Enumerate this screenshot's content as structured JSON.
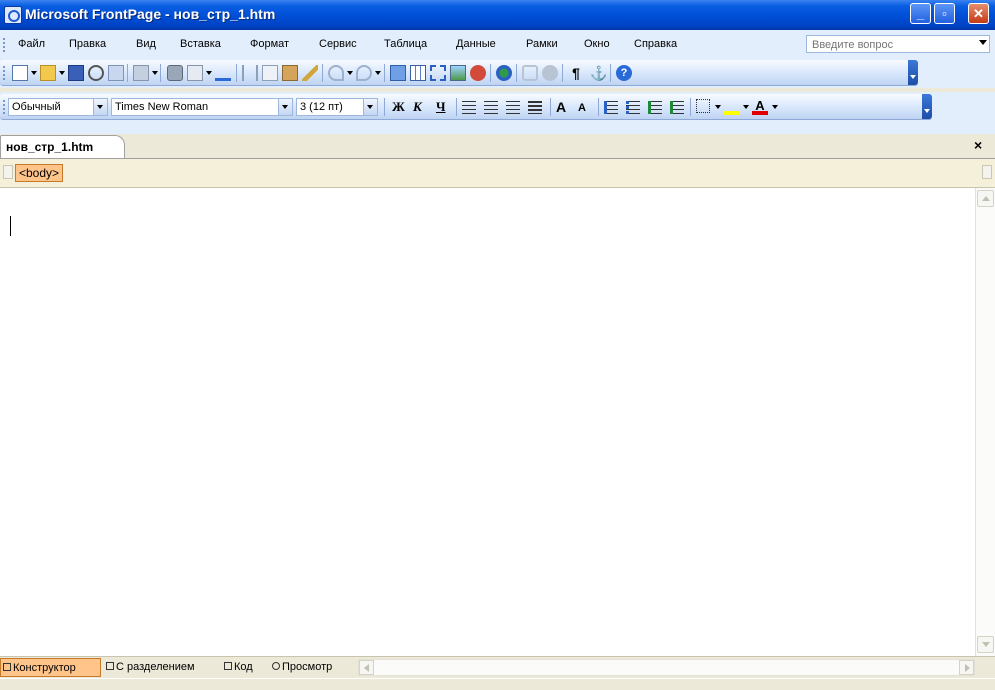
{
  "window": {
    "title": "Microsoft FrontPage - нов_стр_1.htm"
  },
  "menu": {
    "items": [
      "Файл",
      "Правка",
      "Вид",
      "Вставка",
      "Формат",
      "Сервис",
      "Таблица",
      "Данные",
      "Рамки",
      "Окно",
      "Справка"
    ],
    "help_placeholder": "Введите вопрос"
  },
  "formatting": {
    "style": "Обычный",
    "font": "Times New Roman",
    "size": "3 (12 пт)",
    "bold": "Ж",
    "italic": "К",
    "underline": "Ч"
  },
  "document": {
    "tab_name": "нов_стр_1.htm",
    "tag": "<body>",
    "close_glyph": "×"
  },
  "views": [
    "Конструктор",
    "С разделением",
    "Код",
    "Просмотр"
  ],
  "icons": {
    "standard_toolbar": [
      "new-page-icon",
      "open-icon",
      "save-icon",
      "search-icon",
      "publish-icon",
      "web-component-icon",
      "print-icon",
      "print-preview-icon",
      "spelling-icon",
      "cut-icon",
      "copy-icon",
      "paste-icon",
      "format-painter-icon",
      "undo-icon",
      "redo-icon",
      "web-component-icon",
      "table-icon",
      "layers-icon",
      "picture-icon",
      "drawing-icon",
      "hyperlink-icon",
      "refresh-icon",
      "stop-icon",
      "show-all-icon",
      "bookmark-icon",
      "help-icon"
    ],
    "format_toolbar": [
      "align-left-icon",
      "center-icon",
      "align-right-icon",
      "justify-icon",
      "increase-font-icon",
      "decrease-font-icon",
      "numbering-icon",
      "bullets-icon",
      "decrease-indent-icon",
      "increase-indent-icon",
      "borders-icon",
      "highlight-icon",
      "font-color-icon"
    ]
  },
  "colors": {
    "titlebar": "#0050d8",
    "active_tab": "#ffc48a",
    "toolbar": "#e3eefc"
  }
}
